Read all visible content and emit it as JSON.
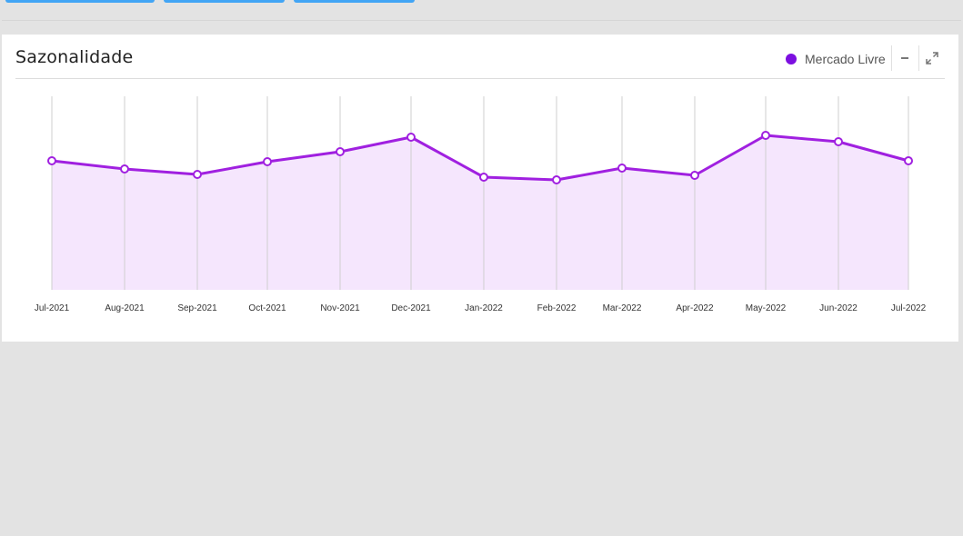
{
  "panel": {
    "title": "Sazonalidade"
  },
  "legend": {
    "label": "Mercado Livre",
    "color": "#7c0fe0"
  },
  "controls": {
    "minimize_icon": "minus-icon",
    "expand_icon": "expand-arrows-icon"
  },
  "colors": {
    "line": "#a020e0",
    "area": "#f5e6fd",
    "grid": "#cfcfcf"
  },
  "chart_data": {
    "type": "area",
    "categories": [
      "Jul-2021",
      "Aug-2021",
      "Sep-2021",
      "Oct-2021",
      "Nov-2021",
      "Dec-2021",
      "Jan-2022",
      "Feb-2022",
      "Mar-2022",
      "Apr-2022",
      "May-2022",
      "Jun-2022",
      "Jul-2022"
    ],
    "series": [
      {
        "name": "Mercado Livre",
        "values": [
          142,
          133,
          127,
          141,
          152,
          168,
          124,
          121,
          134,
          126,
          170,
          163,
          142
        ]
      }
    ],
    "ylim": [
      0,
      213
    ],
    "grid": true,
    "legend": "top-right",
    "title": "Sazonalidade",
    "xlabel": "",
    "ylabel": ""
  }
}
